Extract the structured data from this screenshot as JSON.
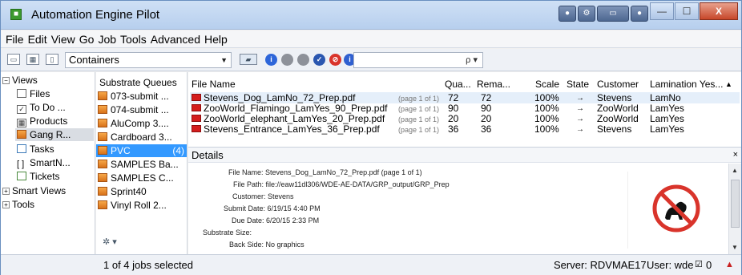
{
  "window": {
    "title": "Automation Engine Pilot",
    "app_icon": "automation-engine-icon"
  },
  "title_tools": [
    "server-icon",
    "settings-icon",
    "panel-icon",
    "record-icon"
  ],
  "window_buttons": {
    "minimize": "—",
    "maximize": "☐",
    "close": "X"
  },
  "menu": [
    "File",
    "Edit",
    "View",
    "Go",
    "Job",
    "Tools",
    "Advanced",
    "Help"
  ],
  "toolbar": {
    "view_label": "Containers",
    "search_value": "",
    "search_icon": "ρ ▾",
    "status_icons": [
      {
        "name": "info-icon",
        "glyph": "i",
        "color": "#2e66d9"
      },
      {
        "name": "waiting-icon",
        "glyph": "",
        "color": "#8d9199"
      },
      {
        "name": "running-icon",
        "glyph": "",
        "color": "#8d9199"
      },
      {
        "name": "done-icon",
        "glyph": "✓",
        "color": "#2b57b0"
      },
      {
        "name": "error-icon",
        "glyph": "⊘",
        "color": "#d9342b"
      },
      {
        "name": "info-icon-2",
        "glyph": "i",
        "color": "#3060d0"
      }
    ]
  },
  "views": {
    "header": "Views",
    "items": [
      "Files",
      "To Do ...",
      "Products",
      "Gang R...",
      "Tasks",
      "SmartN...",
      "Tickets"
    ],
    "smart_views": "Smart Views",
    "tools": "Tools"
  },
  "queues": {
    "header": "Substrate Queues",
    "items": [
      "073-submit ...",
      "074-submit ...",
      "AluComp 3....",
      "Cardboard 3...",
      "PVC",
      "SAMPLES Ba...",
      "SAMPLES C...",
      "Sprint40",
      "Vinyl Roll 2..."
    ],
    "selected_count": "(4)",
    "gear": "✲ ▾"
  },
  "table": {
    "columns": [
      "File Name",
      "Qua...",
      "Rema...",
      "Scale",
      "State",
      "Customer",
      "Lamination Yes..."
    ],
    "rows": [
      {
        "file": "Stevens_Dog_LamNo_72_Prep.pdf",
        "page": "(page 1 of 1)",
        "qty": "72",
        "remaining": "72",
        "scale": "100%",
        "state": "→",
        "customer": "Stevens",
        "lamination": "LamNo"
      },
      {
        "file": "ZooWorld_Flamingo_LamYes_90_Prep.pdf",
        "page": "(page 1 of 1)",
        "qty": "90",
        "remaining": "90",
        "scale": "100%",
        "state": "→",
        "customer": "ZooWorld",
        "lamination": "LamYes"
      },
      {
        "file": "ZooWorld_elephant_LamYes_20_Prep.pdf",
        "page": "(page 1 of 1)",
        "qty": "20",
        "remaining": "20",
        "scale": "100%",
        "state": "→",
        "customer": "ZooWorld",
        "lamination": "LamYes"
      },
      {
        "file": "Stevens_Entrance_LamYes_36_Prep.pdf",
        "page": "(page 1 of 1)",
        "qty": "36",
        "remaining": "36",
        "scale": "100%",
        "state": "→",
        "customer": "Stevens",
        "lamination": "LamYes"
      }
    ]
  },
  "details": {
    "header": "Details",
    "close": "×",
    "fields": [
      {
        "label": "File Name:",
        "value": "Stevens_Dog_LamNo_72_Prep.pdf (page 1 of 1)"
      },
      {
        "label": "File Path:",
        "value": "file://eaw11dl306/WDE-AE-DATA/GRP_output/GRP_Prep"
      },
      {
        "label": "Customer:",
        "value": "Stevens"
      },
      {
        "label": "Submit Date:",
        "value": "6/19/15 4:40 PM"
      },
      {
        "label": "Due Date:",
        "value": "6/20/15 2:33 PM"
      },
      {
        "label": "Substrate Size:",
        "value": ""
      },
      {
        "label": "Back Side:",
        "value": "No graphics"
      }
    ],
    "thumbnail_icon": "no-dogs-sign-icon"
  },
  "status": {
    "selection": "1 of 4 jobs selected",
    "server": "Server: RDVMAE17",
    "user": "User: wde",
    "count": "0"
  },
  "colors": {
    "selection": "#3399ff",
    "pdf": "#d41d1d",
    "title_bar": "#cfe0f5"
  }
}
